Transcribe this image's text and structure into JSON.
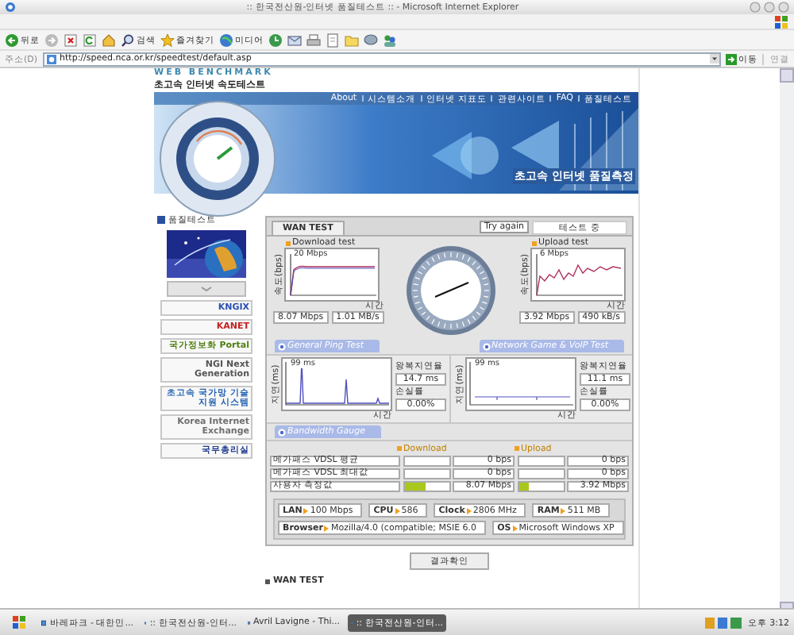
{
  "window": {
    "title": ":: 한국전산원-인터넷 품질테스트 :: - Microsoft Internet Explorer"
  },
  "toolbar": [
    {
      "kind": "back",
      "label": "뒤로"
    },
    {
      "kind": "forward"
    },
    {
      "kind": "stop"
    },
    {
      "kind": "refresh"
    },
    {
      "kind": "home"
    },
    {
      "kind": "search",
      "label": "검색"
    },
    {
      "kind": "favorites",
      "label": "즐겨찾기"
    },
    {
      "kind": "media",
      "label": "미디어"
    },
    {
      "kind": "history"
    },
    {
      "kind": "mail"
    },
    {
      "kind": "print"
    },
    {
      "kind": "edit"
    },
    {
      "kind": "folder"
    },
    {
      "kind": "chat"
    },
    {
      "kind": "people"
    }
  ],
  "address": {
    "label": "주소(D)",
    "url": "http://speed.nca.or.kr/speedtest/default.asp",
    "go": "이동",
    "links": "연결"
  },
  "header": {
    "subtitle": "WEB BENCHMARK",
    "title": "초고속 인터넷 속도테스트"
  },
  "nav": [
    "About",
    "시스템소개",
    "인터넷 지표도",
    "관련사이트",
    "FAQ",
    "품질테스트"
  ],
  "banner": {
    "slogan": "초고속 인터넷 품질측정"
  },
  "sidebar": {
    "title": "품질테스트",
    "banners": [
      {
        "kind": "picture"
      },
      {
        "kind": "plain"
      },
      {
        "kind": "logo",
        "text": "KNGIX",
        "color": "#2a4fb0"
      },
      {
        "kind": "logo",
        "text": "KANET",
        "color": "#c42020"
      },
      {
        "kind": "logo",
        "text": "국가정보화 Portal",
        "color": "#4f7f10"
      },
      {
        "kind": "logo",
        "text": "NGI Next Generation",
        "color": "#555555"
      },
      {
        "kind": "logo",
        "text": "초고속 국가망 기술지원 시스템",
        "color": "#2060b0"
      },
      {
        "kind": "logo",
        "text": "Korea Internet Exchange",
        "color": "#707070"
      },
      {
        "kind": "logo",
        "text": "국무총리실",
        "color": "#203a90"
      }
    ]
  },
  "test": {
    "tab": {
      "label": "WAN TEST",
      "selected": true
    },
    "retry": "Try again",
    "status": "테스트 중",
    "download": {
      "title": "Download test",
      "axis": "속도(bps)",
      "scale": "20 Mbps",
      "time": "시간",
      "rate": "8.07 Mbps",
      "bytes": "1.01 MB/s"
    },
    "upload": {
      "title": "Upload test",
      "axis": "속도(bps)",
      "scale": "6 Mbps",
      "time": "시간",
      "rate": "3.92 Mbps",
      "bytes": "490 kB/s"
    },
    "ping_tabs": [
      "General Ping Test",
      "Network Game & VoIP Test"
    ],
    "ping": [
      {
        "axis": "지연(ms)",
        "scale": "99 ms",
        "time": "시간",
        "delay_label": "왕복지연율",
        "delay": "14.7 ms",
        "loss_label": "손실률",
        "loss": "0.00%"
      },
      {
        "axis": "지연(ms)",
        "scale": "99 ms",
        "time": "시간",
        "delay_label": "왕복지연율",
        "delay": "11.1 ms",
        "loss_label": "손실률",
        "loss": "0.00%"
      }
    ],
    "bandwidth": {
      "title": "Bandwidth Gauge",
      "columns": [
        "Download",
        "Upload"
      ],
      "rows": [
        {
          "name": "메가패스 VDSL 평균",
          "download": {
            "level": 0,
            "value": "0 bps"
          },
          "upload": {
            "level": 0,
            "value": "0 bps"
          }
        },
        {
          "name": "메가패스 VDSL 최대값",
          "download": {
            "level": 0,
            "value": "0 bps"
          },
          "upload": {
            "level": 0,
            "value": "0 bps"
          }
        },
        {
          "name": "사용자 측정값",
          "download": {
            "level": 0.45,
            "value": "8.07 Mbps"
          },
          "upload": {
            "level": 0.22,
            "value": "3.92 Mbps"
          }
        }
      ]
    },
    "system": [
      [
        {
          "label": "LAN",
          "value": "100 Mbps"
        },
        {
          "label": "CPU",
          "value": "586"
        },
        {
          "label": "Clock",
          "value": "2806 MHz"
        },
        {
          "label": "RAM",
          "value": "511 MB"
        }
      ],
      [
        {
          "label": "Browser",
          "value": "Mozilla/4.0 (compatible; MSIE 6.0"
        },
        {
          "label": "OS",
          "value": "Microsoft Windows XP"
        }
      ]
    ],
    "confirm": "결과확인"
  },
  "footer": "WAN TEST",
  "taskbar": {
    "items": [
      {
        "label": "바레파크 - 대한민...",
        "selected": false
      },
      {
        "label": ":: 한국전산원-인터...",
        "selected": false
      },
      {
        "label": "Avril Lavigne - Thi...",
        "selected": false
      },
      {
        "label": ":: 한국전산원-인터...",
        "selected": true
      }
    ],
    "clock": "오후 3:12"
  }
}
